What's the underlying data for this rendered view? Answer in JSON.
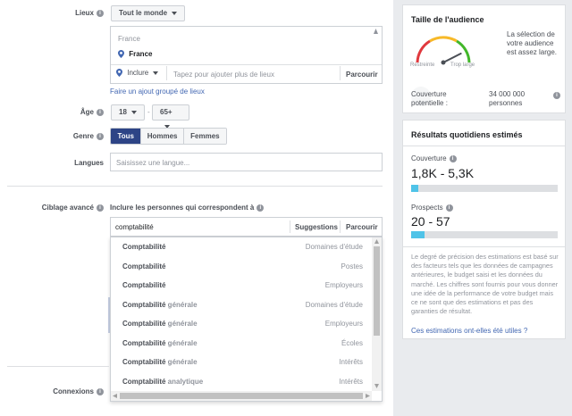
{
  "form": {
    "locations_label": "Lieux",
    "locations_dropdown": "Tout le monde",
    "country_header": "France",
    "selected_location": "France",
    "include_label": "Inclure",
    "location_placeholder": "Tapez pour ajouter plus de lieux",
    "browse_label": "Parcourir",
    "bulk_link": "Faire un ajout groupé de lieux",
    "age_label": "Âge",
    "age_min": "18",
    "age_separator": "-",
    "age_max": "65+",
    "gender_label": "Genre",
    "gender_options": [
      "Tous",
      "Hommes",
      "Femmes"
    ],
    "languages_label": "Langues",
    "languages_placeholder": "Saisissez une langue...",
    "detailed_targeting_label": "Ciblage avancé",
    "include_people_label": "Inclure les personnes qui correspondent à",
    "search_value": "comptabilité",
    "suggestions_label": "Suggestions",
    "browse2_label": "Parcourir",
    "connections_label": "Connexions"
  },
  "suggestions": [
    {
      "title": "Comptabilité",
      "suffix": "",
      "category": "Domaines d'étude"
    },
    {
      "title": "Comptabilité",
      "suffix": "",
      "category": "Postes"
    },
    {
      "title": "Comptabilité",
      "suffix": "",
      "category": "Employeurs"
    },
    {
      "title": "Comptabilité",
      "suffix": " générale",
      "category": "Domaines d'étude"
    },
    {
      "title": "Comptabilité",
      "suffix": " générale",
      "category": "Employeurs"
    },
    {
      "title": "Comptabilité",
      "suffix": " générale",
      "category": "Écoles"
    },
    {
      "title": "Comptabilité",
      "suffix": " générale",
      "category": "Intérêts"
    },
    {
      "title": "Comptabilité",
      "suffix": " analytique",
      "category": "Intérêts"
    }
  ],
  "audience": {
    "title": "Taille de l'audience",
    "description": "La sélection de votre audience est assez large.",
    "gauge_left": "Restreinte",
    "gauge_right": "Trop large",
    "reach_label": "Couverture potentielle :",
    "reach_value": "34 000 000 personnes",
    "gauge_level": 0.85
  },
  "daily": {
    "title": "Résultats quotidiens estimés",
    "reach_label": "Couverture",
    "reach_value": "1,8K - 5,3K",
    "reach_fill": 0.05,
    "prospects_label": "Prospects",
    "prospects_value": "20 - 57",
    "prospects_fill": 0.09,
    "disclaimer": "Le degré de précision des estimations est basé sur des facteurs tels que les données de campagnes antérieures, le budget saisi et les données du marché. Les chiffres sont fournis pour vous donner une idée de la performance de votre budget mais ce ne sont que des estimations et pas des garanties de résultat.",
    "help_link": "Ces estimations ont-elles été utiles ?"
  },
  "colors": {
    "selected_gender": "#2d4486",
    "bar_fill": "#4fc3e8",
    "link": "#4267b2"
  }
}
